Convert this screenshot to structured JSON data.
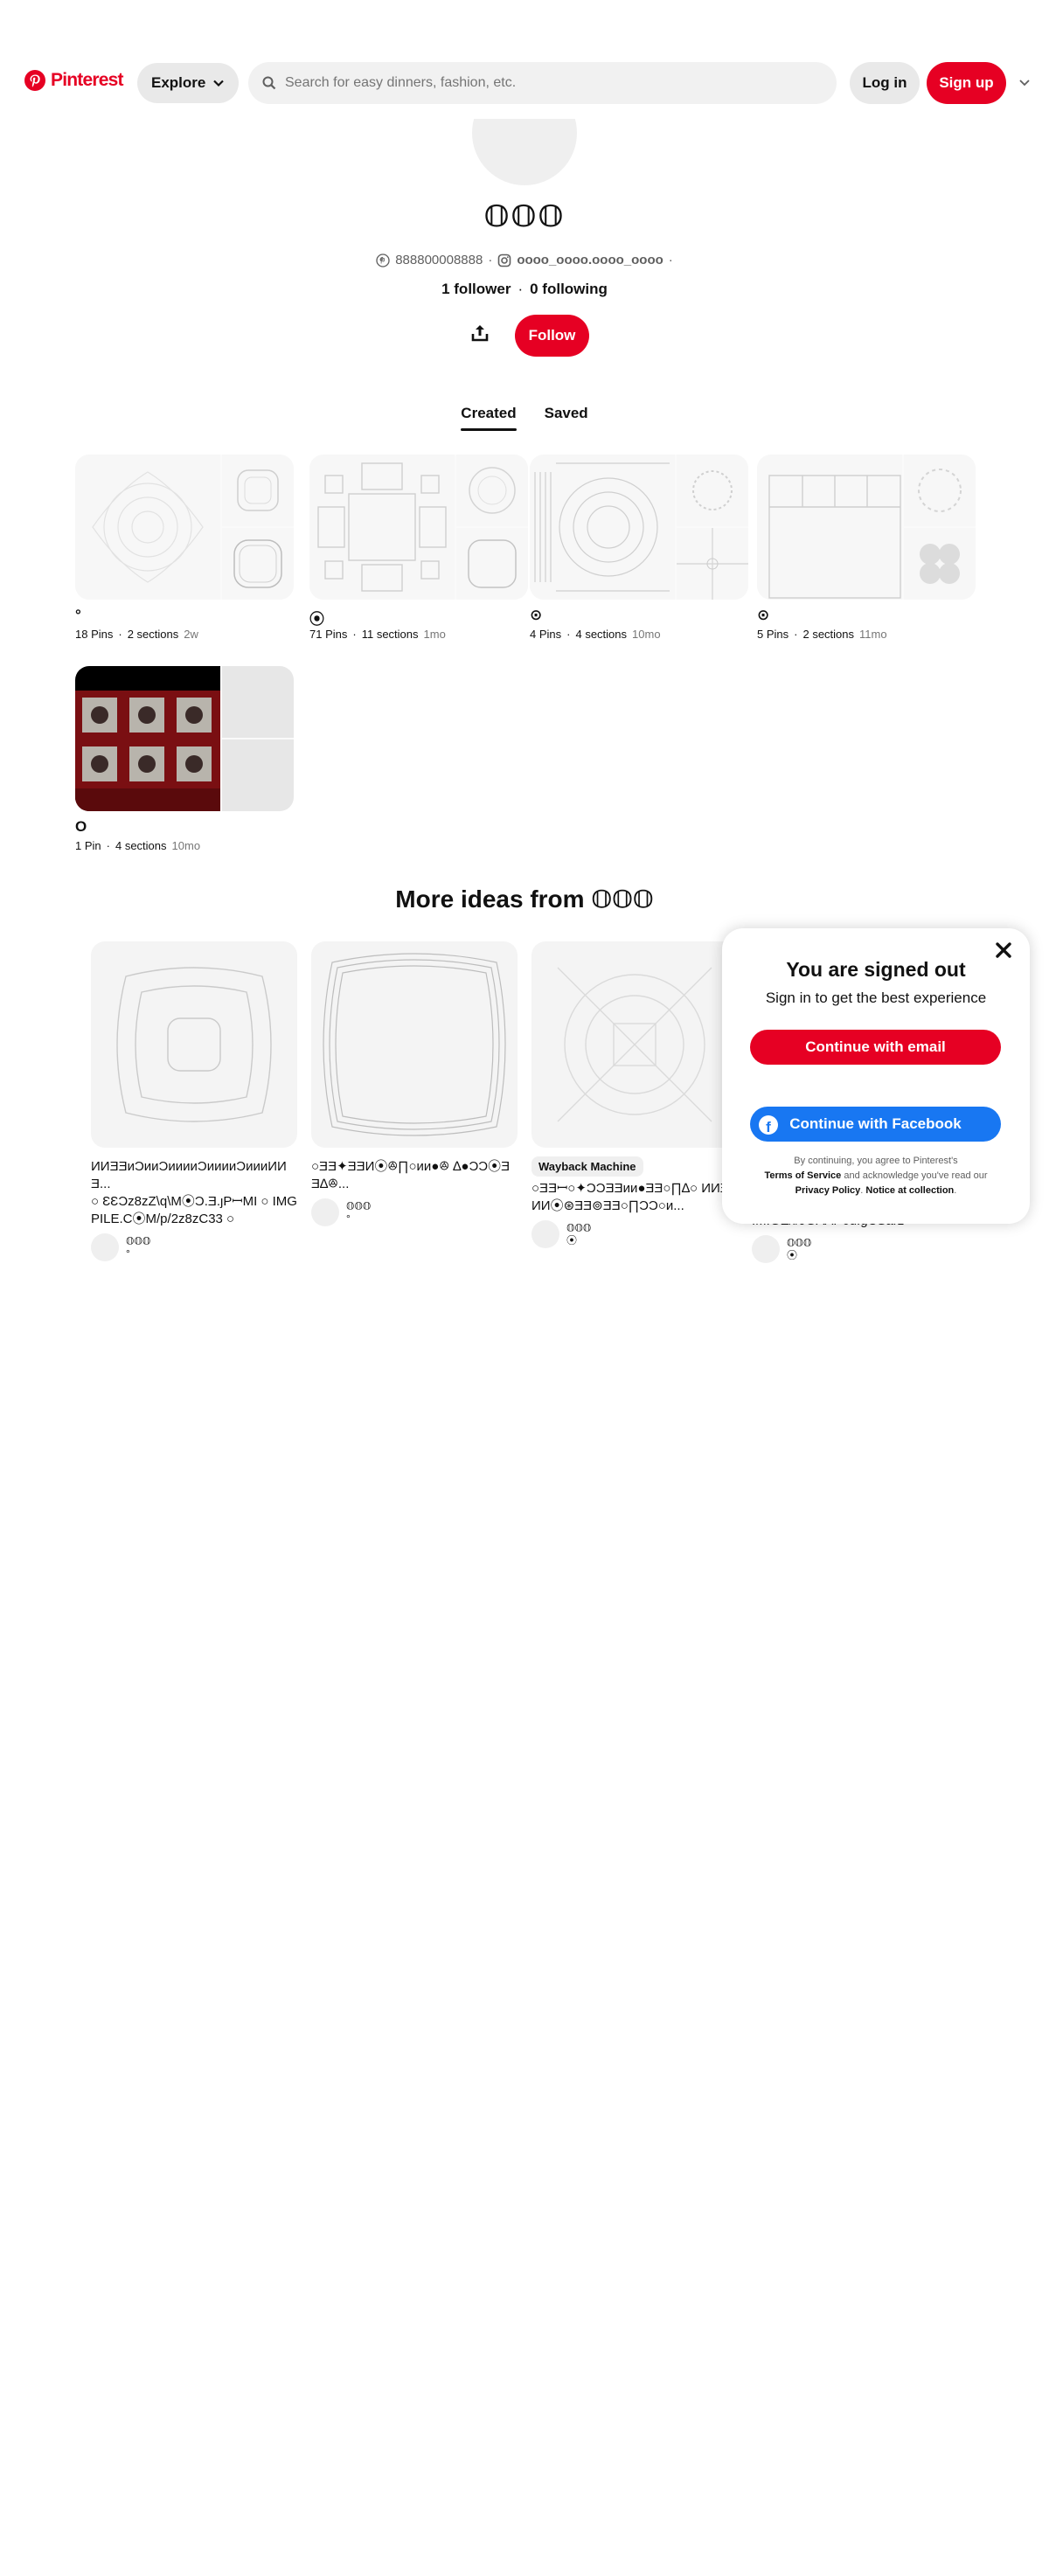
{
  "header": {
    "brand": "Pinterest",
    "explore_label": "Explore",
    "search_placeholder": "Search for easy dinners, fashion, etc.",
    "login_label": "Log in",
    "signup_label": "Sign up"
  },
  "profile": {
    "name": "𝕆𝕆𝕆",
    "pinterest_handle": "888800008888",
    "instagram_handle": "oooo_oooo.oooo_oooo",
    "followers": "1 follower",
    "following": "0 following",
    "follow_label": "Follow"
  },
  "tabs": [
    {
      "label": "Created"
    },
    {
      "label": "Saved"
    }
  ],
  "boards": [
    {
      "title": "°",
      "pins": "18 Pins",
      "sections": "2 sections",
      "ago": "2w"
    },
    {
      "title": "⦿",
      "pins": "71 Pins",
      "sections": "11 sections",
      "ago": "1mo"
    },
    {
      "title": "⊙",
      "pins": "4 Pins",
      "sections": "4 sections",
      "ago": "10mo"
    },
    {
      "title": "⊙",
      "pins": "5 Pins",
      "sections": "2 sections",
      "ago": "11mo"
    },
    {
      "title": "O",
      "pins": "1 Pin",
      "sections": "4 sections",
      "ago": "10mo"
    }
  ],
  "more_ideas": {
    "title": "More ideas from 𝕆𝕆𝕆"
  },
  "pins": [
    {
      "title": "ИИƎƎᴎƆᴎᴎƆᴎᴎᴎᴎƆᴎᴎᴎᴎƆᴎᴎᴎИИƎ...",
      "desc": "○ ƐƐƆz8zZ\\q\\M⦿Ɔ.Ǝ.ȷPꟷMI ○ IMGPILE.C⦿M/p/2z8zC33 ○",
      "author": "𝕆𝕆𝕆",
      "author_sub": "°"
    },
    {
      "title": "○ƎƎ✦ƎƎИ⦿ꔮ∏○ᴎᴎ●ꔮ ∆●ƆƆ⦿ƎƎ∆ꔮ...",
      "desc": "",
      "author": "𝕆𝕆𝕆",
      "author_sub": "°"
    },
    {
      "title": "○ƎƎꟷ○✦ƆƆƎƎᴎᴎ●ƎƎ○∏∆○ ИИƎƎИИ⦿⊛ƎƎ⊚ƎƎ○∏ƆƆ○ᴎ...",
      "desc": "",
      "badge": "Wayback Machine",
      "author": "𝕆𝕆𝕆",
      "author_sub": "⦿"
    },
    {
      "title": "",
      "desc": "IM.GE/i/JGAAP6u.gCSarz ○",
      "author": "𝕆𝕆𝕆",
      "author_sub": "⦿"
    }
  ],
  "modal": {
    "title": "You are signed out",
    "subtitle": "Sign in to get the best experience",
    "email_label": "Continue with email",
    "facebook_label": "Continue with Facebook",
    "legal_prefix": "By continuing, you agree to Pinterest's",
    "terms": "Terms of Service",
    "legal_mid": "and acknowledge you've read our",
    "privacy": "Privacy Policy",
    "notice": "Notice at collection"
  },
  "colors": {
    "brand_red": "#e60023",
    "facebook_blue": "#1877f2"
  }
}
